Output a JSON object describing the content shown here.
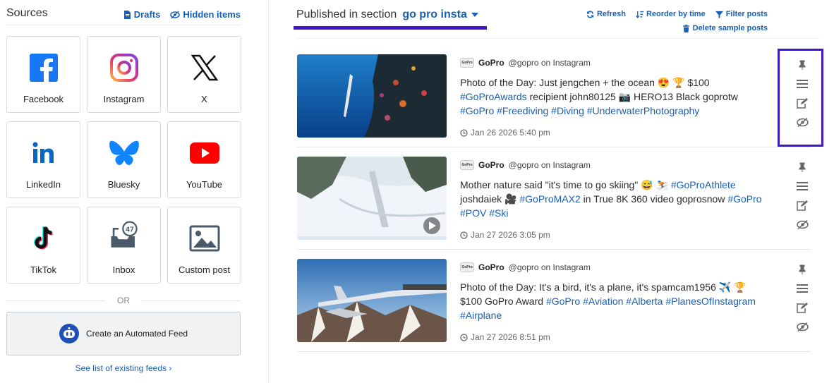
{
  "sources": {
    "title": "Sources",
    "drafts_label": "Drafts",
    "hidden_items_label": "Hidden items",
    "tiles": [
      {
        "label": "Facebook",
        "icon": "facebook-icon"
      },
      {
        "label": "Instagram",
        "icon": "instagram-icon"
      },
      {
        "label": "X",
        "icon": "x-icon"
      },
      {
        "label": "LinkedIn",
        "icon": "linkedin-icon"
      },
      {
        "label": "Bluesky",
        "icon": "bluesky-icon"
      },
      {
        "label": "YouTube",
        "icon": "youtube-icon"
      },
      {
        "label": "TikTok",
        "icon": "tiktok-icon"
      },
      {
        "label": "Inbox",
        "icon": "inbox-icon",
        "badge": "47"
      },
      {
        "label": "Custom post",
        "icon": "image-icon"
      }
    ],
    "or_label": "OR",
    "automated_feed_label": "Create an Automated Feed",
    "see_list_label": "See list of existing feeds ›"
  },
  "section": {
    "prefix": "Published in section",
    "name": "go pro insta"
  },
  "toolbar": {
    "refresh": "Refresh",
    "reorder": "Reorder by time",
    "filter": "Filter posts",
    "delete_samples": "Delete sample posts"
  },
  "posts": [
    {
      "author": "GoPro",
      "handle": "@gopro on Instagram",
      "text": "Photo of the Day: Just jengchen + the ocean 😍 🏆 $100",
      "text2": "#GoProAwards",
      "text3": " recipient john80125 📷 HERO13 Black goprotw",
      "hashtags": "#GoPro #Freediving #Diving #UnderwaterPhotography",
      "date": "Jan 26 2026 5:40 pm"
    },
    {
      "author": "GoPro",
      "handle": "@gopro on Instagram",
      "text": "Mother nature said \"it's time to go skiing\" 😅 ⛷️ ",
      "text2": "#GoProAthlete",
      "text3": " joshdaiek 🎥 ",
      "text4": "#GoProMAX2",
      "text5": " in True 8K 360 video goprosnow ",
      "hashtags": "#GoPro #POV #Ski",
      "date": "Jan 27 2026 3:05 pm"
    },
    {
      "author": "GoPro",
      "handle": "@gopro on Instagram",
      "text": "Photo of the Day: It's a bird, it's a plane, it's spamcam1956 ✈️ 🏆 $100 GoPro Award ",
      "hashtags": "#GoPro #Aviation #Alberta #PlanesOfInstagram #Airplane",
      "date": "Jan 27 2026 8:51 pm"
    }
  ],
  "colors": {
    "accent": "#1a5fb4",
    "highlight": "#3f17c6"
  }
}
